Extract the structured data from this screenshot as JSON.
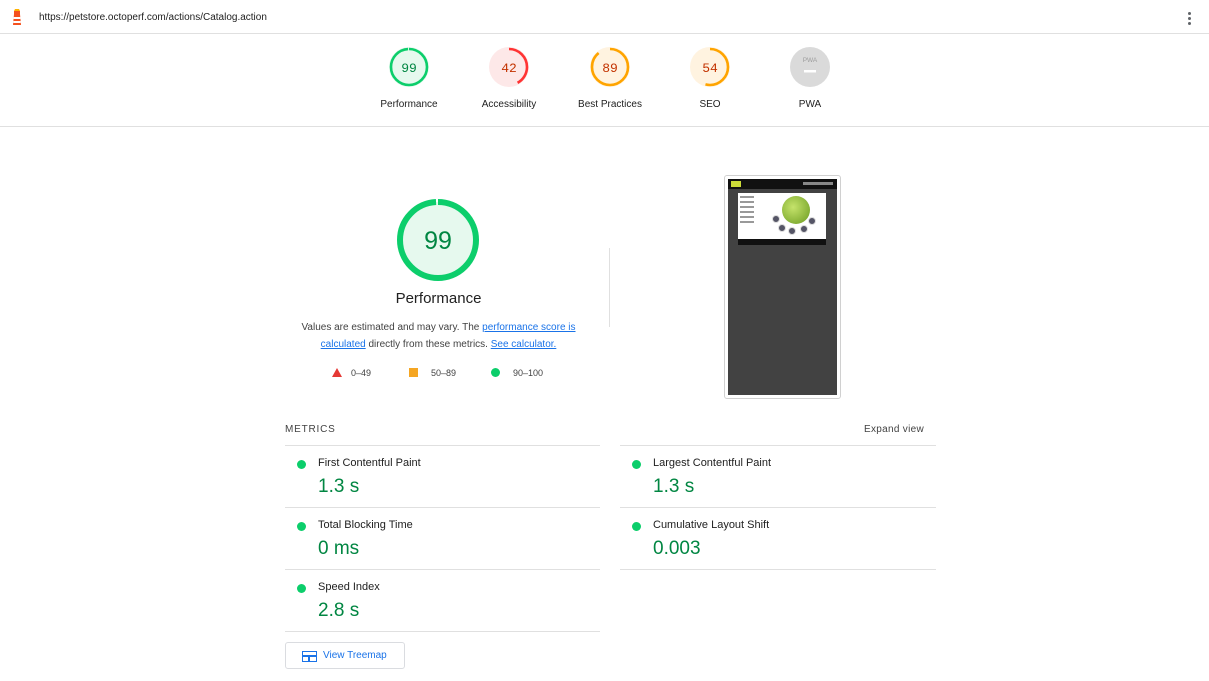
{
  "url_bar": {
    "url": "https://petstore.octoperf.com/actions/Catalog.action"
  },
  "score_header": {
    "categories": [
      {
        "label": "Performance",
        "score": "99",
        "fraction": 0.99,
        "color": "#0cce6b",
        "text_color": "#018642",
        "bg": "#e6f9ee"
      },
      {
        "label": "Accessibility",
        "score": "42",
        "fraction": 0.42,
        "color": "#ff3333",
        "text_color": "#c33300",
        "bg": "#fde8e8"
      },
      {
        "label": "Best Practices",
        "score": "89",
        "fraction": 0.89,
        "color": "#ffa400",
        "text_color": "#c33300",
        "bg": "#fff3e0"
      },
      {
        "label": "SEO",
        "score": "54",
        "fraction": 0.54,
        "color": "#ffa400",
        "text_color": "#c33300",
        "bg": "#fff3e0"
      },
      {
        "label": "PWA",
        "badge": "PWA",
        "color": "#bdbdbd"
      }
    ]
  },
  "performance": {
    "score": "99",
    "fraction": 0.99,
    "title": "Performance",
    "desc_prefix": "Values are estimated and may vary. The ",
    "desc_link1": "performance score is calculated",
    "desc_middle": " directly from these metrics. ",
    "desc_link2": "See calculator."
  },
  "legend": {
    "fail": "0–49",
    "average": "50–89",
    "pass": "90–100"
  },
  "metrics": {
    "heading": "METRICS",
    "expand_label": "Expand view",
    "items": [
      {
        "name": "First Contentful Paint",
        "value": "1.3 s"
      },
      {
        "name": "Largest Contentful Paint",
        "value": "1.3 s"
      },
      {
        "name": "Total Blocking Time",
        "value": "0 ms"
      },
      {
        "name": "Cumulative Layout Shift",
        "value": "0.003"
      },
      {
        "name": "Speed Index",
        "value": "2.8 s"
      }
    ]
  },
  "treemap": {
    "label": "View Treemap"
  },
  "colors": {
    "pass": "#0cce6b",
    "average": "#ffa400",
    "fail": "#ff3333",
    "link": "#1a73e8"
  }
}
